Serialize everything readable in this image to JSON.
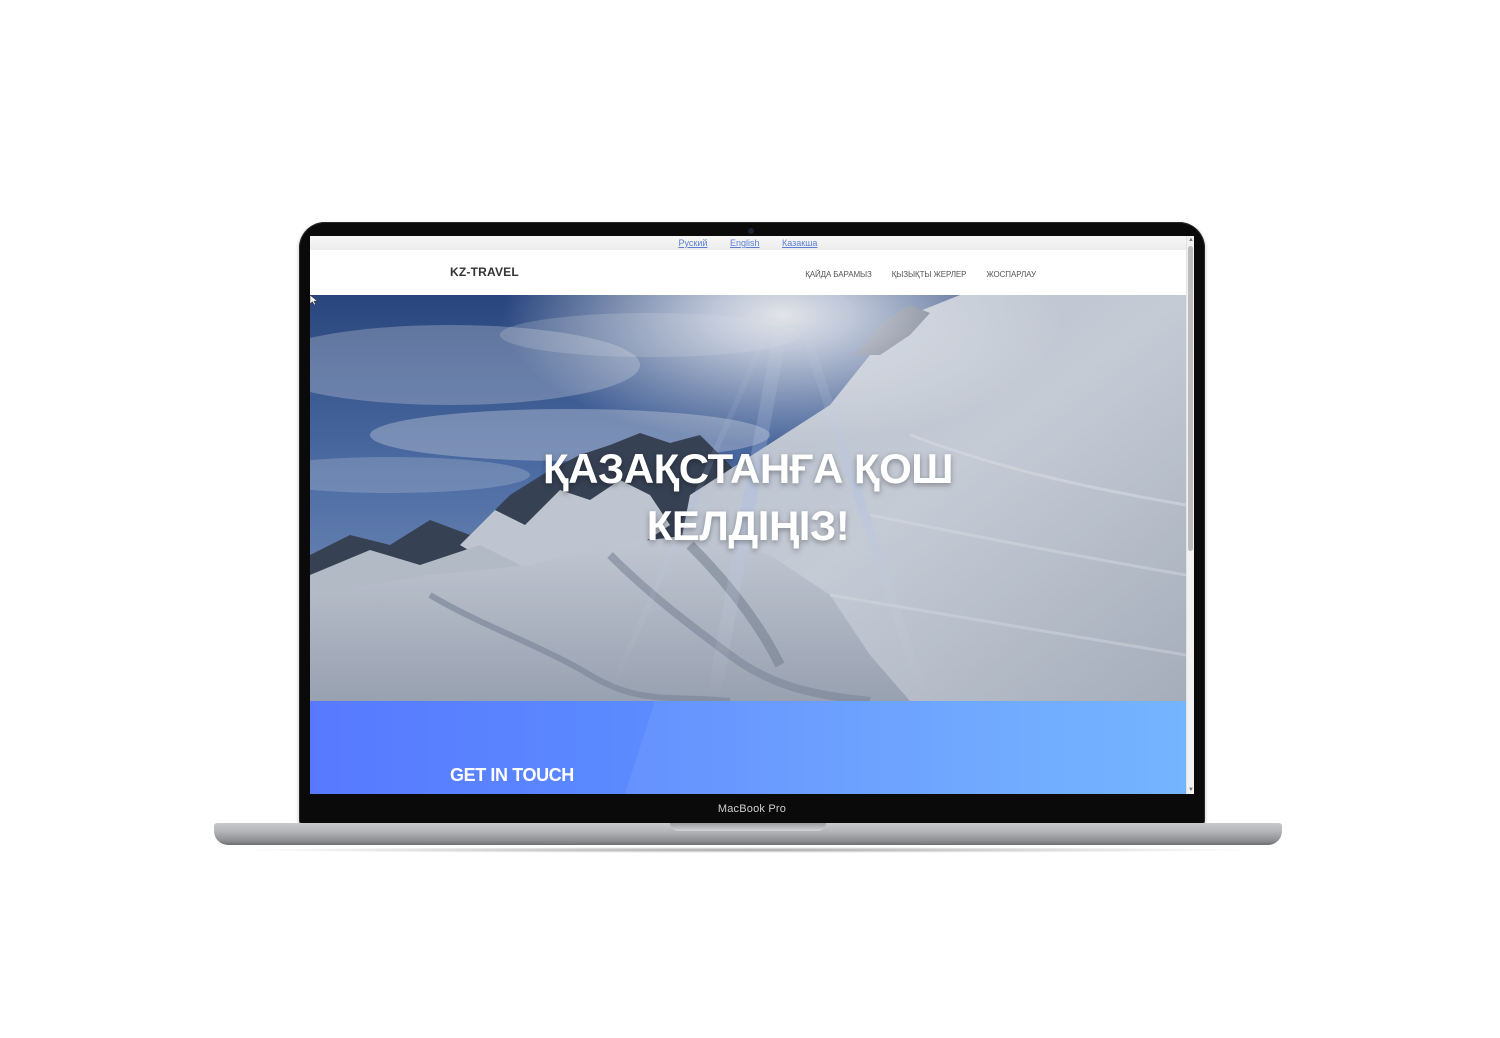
{
  "device": {
    "model_label": "MacBook Pro"
  },
  "languages": [
    {
      "label": "Руский"
    },
    {
      "label": "English"
    },
    {
      "label": "Казакша"
    }
  ],
  "header": {
    "brand": "KZ-TRAVEL",
    "nav": [
      {
        "label": "ҚАЙДА БАРАМЫЗ"
      },
      {
        "label": "ҚЫЗЫҚТЫ ЖЕРЛЕР"
      },
      {
        "label": "ЖОСПАРЛАУ"
      }
    ]
  },
  "hero": {
    "title_line1": "ҚАЗАҚСТАНҒА ҚОШ",
    "title_line2": "КЕЛДІҢІЗ!"
  },
  "contact": {
    "title": "GET IN TOUCH"
  },
  "colors": {
    "contact_gradient_start": "#5879ff",
    "contact_gradient_end": "#6ab0ff",
    "lang_link": "#5d7fd3",
    "bezel": "#0a0a0a"
  }
}
